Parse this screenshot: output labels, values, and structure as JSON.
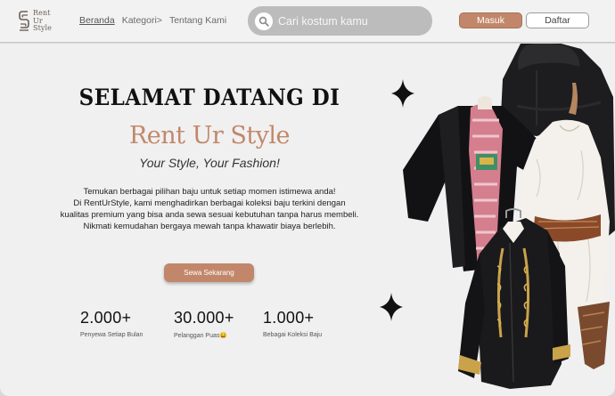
{
  "brand": {
    "logo_lines": [
      "Rent",
      "Ur",
      "Style"
    ]
  },
  "nav": {
    "items": [
      {
        "label": "Beranda",
        "active": true
      },
      {
        "label": "Kategori>",
        "active": false
      },
      {
        "label": "Tentang Kami",
        "active": false
      }
    ]
  },
  "search": {
    "placeholder": "Cari kostum kamu",
    "icon": "search-icon"
  },
  "auth": {
    "login_label": "Masuk",
    "register_label": "Daftar"
  },
  "hero": {
    "heading": "SELAMAT DATANG DI",
    "brand_name": "Rent Ur Style",
    "tagline": "Your Style, Your Fashion!",
    "description": [
      "Temukan berbagai pilihan baju untuk setiap momen istimewa anda!",
      "Di RentUrStyle, kami menghadirkan berbagai koleksi baju terkini dengan",
      "kualitas premium yang bisa anda sewa sesuai kebutuhan tanpa harus membeli.",
      "Nikmati kemudahan bergaya mewah tanpa khawatir biaya berlebih."
    ],
    "cta_label": "Sewa Sekarang"
  },
  "stats": [
    {
      "value": "2.000+",
      "label": "Penyewa Setiap Bulan"
    },
    {
      "value": "30.000+",
      "label": "Pelanggan Puas😄"
    },
    {
      "value": "1.000+",
      "label": "Bebagai Koleksi Baju"
    }
  ],
  "colors": {
    "accent": "#c2876a",
    "background": "#f0f0f0",
    "navbar": "#f2f2f2",
    "search_bg": "#bcbcbc"
  }
}
